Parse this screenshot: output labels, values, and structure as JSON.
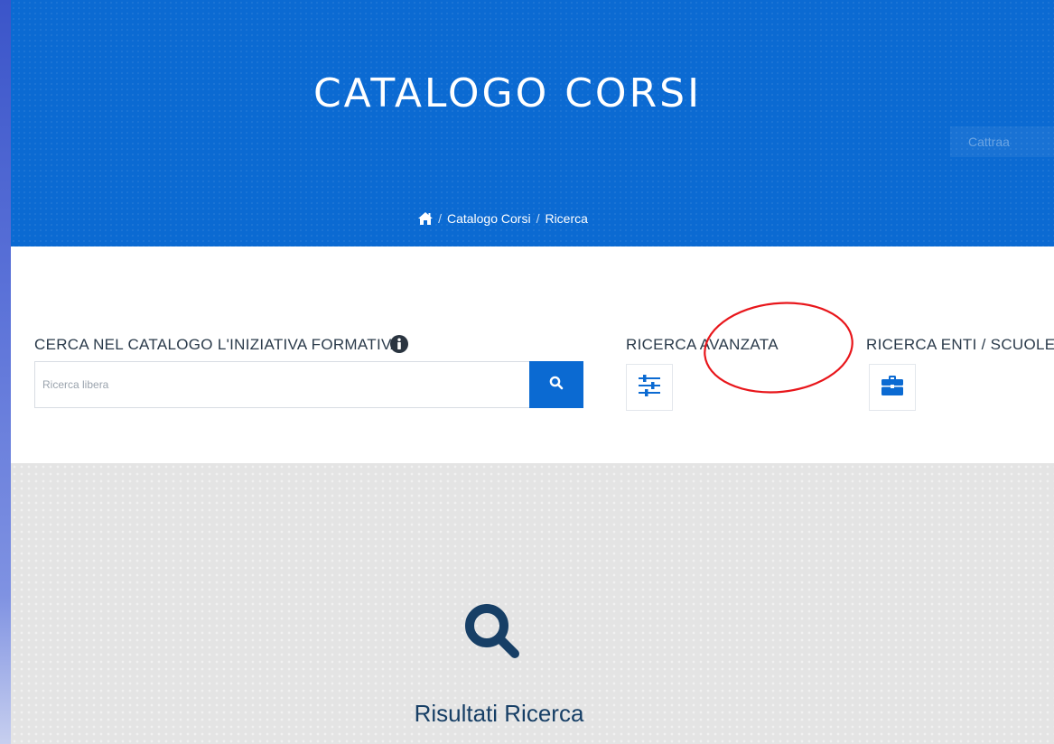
{
  "header": {
    "title": "CATALOGO CORSI",
    "faint_text": "Cattraa",
    "background_color": "#0b6ad2"
  },
  "breadcrumb": {
    "home_icon": "home-icon",
    "items": [
      "Catalogo Corsi",
      "Ricerca"
    ],
    "separator": "/"
  },
  "search": {
    "label": "CERCA NEL CATALOGO L'INIZIATIVA FORMATIVA",
    "info_icon": "info-icon",
    "placeholder": "Ricerca libera",
    "button_icon": "search-icon"
  },
  "advanced": {
    "label": "RICERCA AVANZATA",
    "icon": "sliders-icon"
  },
  "entities": {
    "label": "RICERCA ENTI / SCUOLE",
    "icon": "briefcase-icon"
  },
  "results": {
    "icon": "search-icon",
    "title": "Risultati Ricerca"
  },
  "colors": {
    "accent": "#0b6ad2",
    "annotation": "#e8161b",
    "results_title": "#173f66"
  }
}
